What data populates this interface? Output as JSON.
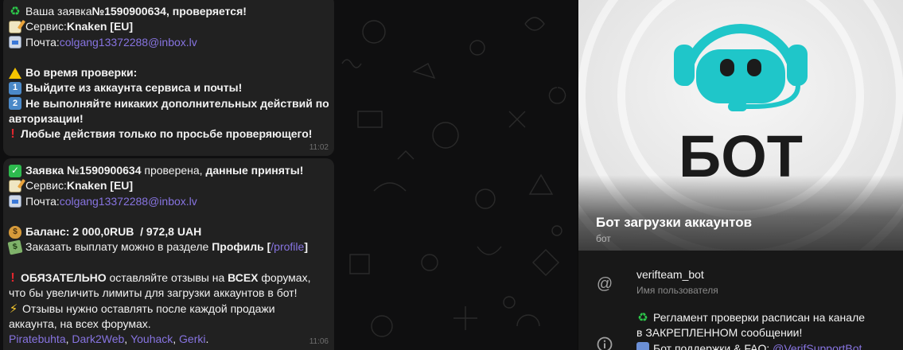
{
  "messages": [
    {
      "time": "11:02",
      "lines": {
        "l1_pre": "Ваша заявка ",
        "l1_id": "№1590900634",
        "l1_post": ", проверяется!",
        "l2_pre": "Сервис: ",
        "l2_val": "Knaken [EU]",
        "l3_pre": "Почта: ",
        "l3_val": "colgang13372288@inbox.lv",
        "l4": "Во время проверки:",
        "l5": "Выйдите из аккаунта сервиса и почты!",
        "l6a": "Не выполняйте никаких дополнительных действий по",
        "l6b": "авторизации!",
        "l7": "Любые действия только по просьбе проверяющего!",
        "num1": "1",
        "num2": "2"
      }
    },
    {
      "time": "11:06",
      "lines": {
        "l1_id": "Заявка №1590900634",
        "l1_mid": " проверена, ",
        "l1_post": "данные приняты!",
        "l2_pre": "Сервис: ",
        "l2_val": "Knaken [EU]",
        "l3_pre": "Почта: ",
        "l3_val": "colgang13372288@inbox.lv",
        "l4": "Баланс: 2 000,0RUB  / 972,8 UAH",
        "l5_pre": "Заказать выплату можно в разделе ",
        "l5_bold": "Профиль [",
        "l5_link": "/profile",
        "l5_close": "]",
        "l6_bold1": "ОБЯЗАТЕЛЬНО",
        "l6_mid": " оставляйте отзывы на ",
        "l6_bold2": "ВСЕХ",
        "l6_post": " форумах,",
        "l7": "что бы увеличить лимиты для загрузки аккаунтов в бот!",
        "l8": "Отзывы нужно оставлять после каждой продажи",
        "l9": "аккаунта, на всех форумах.",
        "forum1": "Piratebuhta",
        "forum2": "Dark2Web",
        "forum3": "Youhack",
        "forum4": "Gerki",
        "sep": ", ",
        "end": "."
      }
    }
  ],
  "profile": {
    "avatar_text": "БОТ",
    "name": "Бот загрузки аккаунтов",
    "subtitle": "бот",
    "username": "verifteam_bot",
    "username_label": "Имя пользователя",
    "desc_l1": "Регламент проверки расписан на канале",
    "desc_l2": "в ЗАКРЕПЛЕННОМ сообщении!",
    "desc_l3_pre": "Бот поддержки & FAQ: ",
    "desc_l3_link": "@VerifSupportBot"
  },
  "colors": {
    "link": "#8774e1",
    "bubble": "#212121",
    "logo_teal": "#1fc6c9"
  }
}
